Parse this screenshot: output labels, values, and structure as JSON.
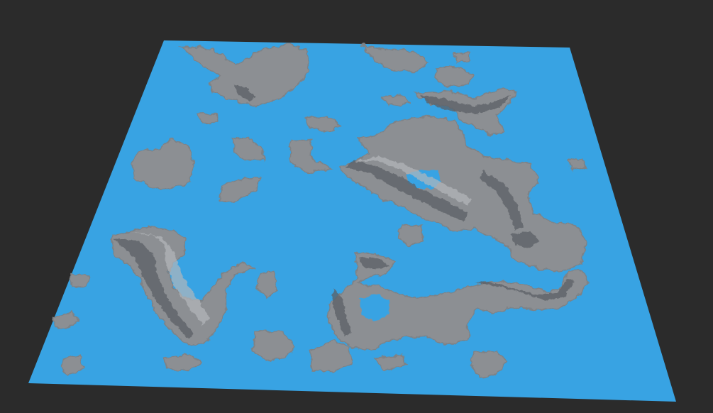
{
  "viewport": {
    "background_color": "#2b2b2b"
  },
  "terrain": {
    "water_color": "#38a3e3",
    "land_color": "#8c8f93",
    "land_shadow_color": "#5c6066",
    "land_highlight_color": "#b3b6ba",
    "coast_color": "#7e8286",
    "features": [
      "north-island",
      "central-landmass",
      "crater-lake",
      "northeast-ridge",
      "west-landmass",
      "southwest-ridge",
      "southeast-landmass",
      "small-islets"
    ]
  }
}
